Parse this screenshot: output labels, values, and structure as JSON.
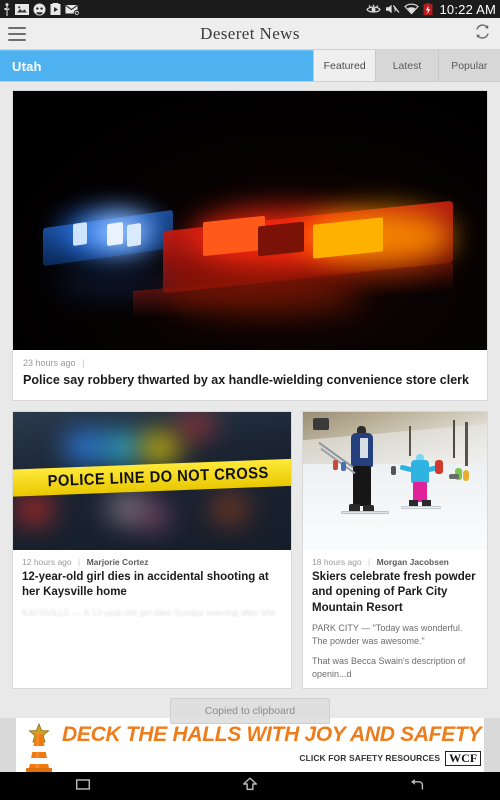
{
  "statusbar": {
    "icons_left": [
      "usb-icon",
      "image-icon",
      "chat-icon",
      "screen-record-icon",
      "email-icon"
    ],
    "icons_right": [
      "eye-icon",
      "mute-icon",
      "wifi-icon",
      "battery-charging-icon"
    ],
    "time": "10:22 AM"
  },
  "actionbar": {
    "menu_icon": "hamburger-menu-icon",
    "title": "Deseret News",
    "refresh_icon": "refresh-icon"
  },
  "tabbar": {
    "section_label": "Utah",
    "section_color": "#4db2ef",
    "tabs": [
      {
        "label": "Featured",
        "active": true
      },
      {
        "label": "Latest",
        "active": false
      },
      {
        "label": "Popular",
        "active": false
      }
    ]
  },
  "feed": {
    "hero": {
      "image_alt": "police-car-lightbar-at-night",
      "timestamp": "23 hours ago",
      "separator": "|",
      "byline": "",
      "title": "Police say robbery thwarted by ax handle-wielding convenience store clerk"
    },
    "cards": [
      {
        "image_alt": "police-line-do-not-cross-tape",
        "image_text": "POLICE LINE DO NOT CROSS",
        "timestamp": "12 hours ago",
        "separator": "|",
        "byline": "Marjorie Cortez",
        "title": "12-year-old girl dies in accidental shooting at her Kaysville home",
        "excerpt": ""
      },
      {
        "image_alt": "skiers-on-snowy-slope",
        "timestamp": "18 hours ago",
        "separator": "|",
        "byline": "Morgan Jacobsen",
        "title": "Skiers celebrate fresh powder and opening of Park City Mountain Resort",
        "excerpt_1": "PARK CITY — \"Today was wonderful. The powder was awesome.\"",
        "excerpt_2": "That was Becca Swain's description of openin...d"
      }
    ]
  },
  "toast": {
    "message": "Copied to clipboard"
  },
  "ad": {
    "headline": "DECK THE HALLS WITH JOY AND SAFETY",
    "subline": "CLICK FOR SAFETY RESOURCES",
    "logo": "WCF",
    "accent_color": "#ef7c1a",
    "icon": "traffic-cone-with-star-icon"
  },
  "navbar": {
    "buttons": [
      {
        "name": "recents-button",
        "icon": "recents-icon"
      },
      {
        "name": "home-button",
        "icon": "home-icon"
      },
      {
        "name": "back-button",
        "icon": "back-icon"
      }
    ]
  }
}
